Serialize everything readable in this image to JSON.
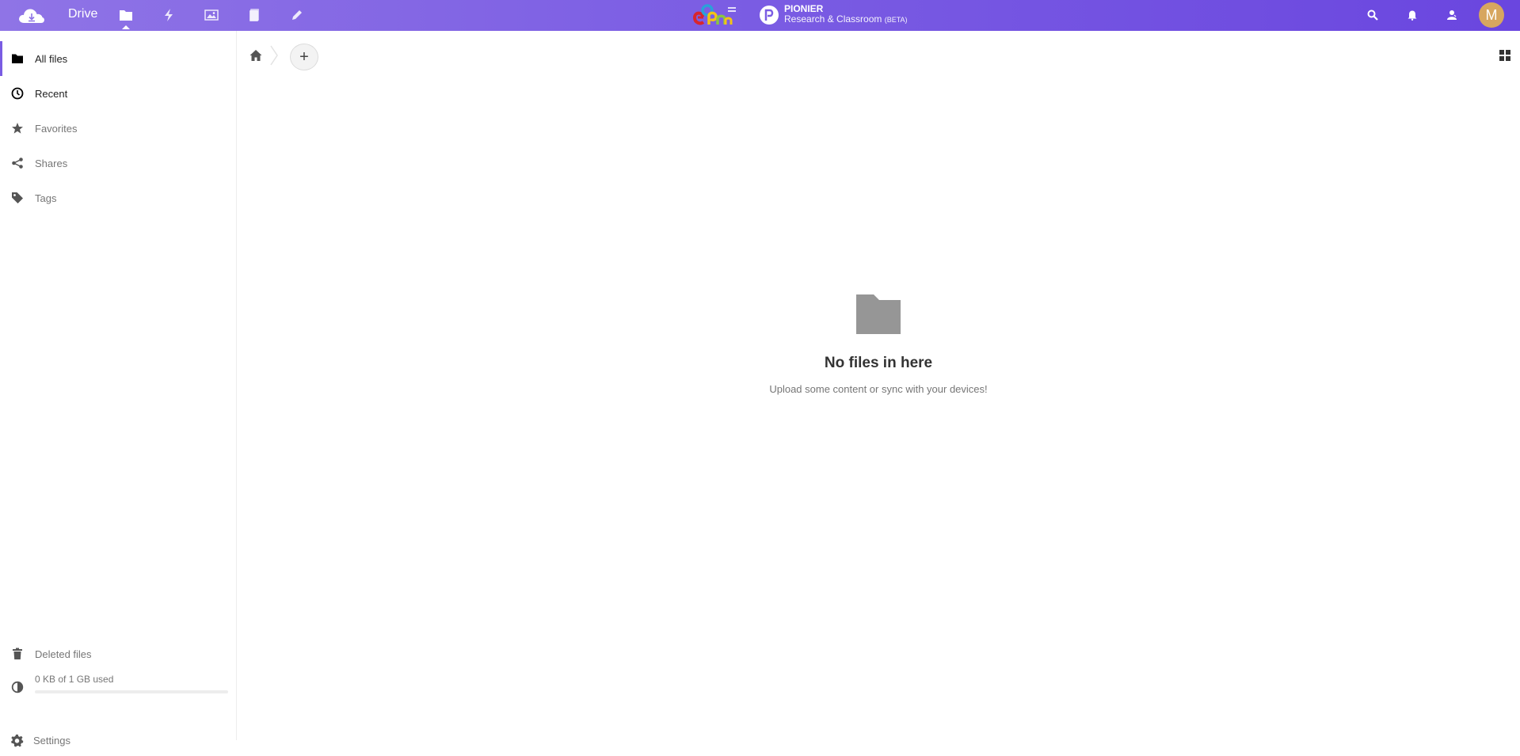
{
  "header": {
    "app_name": "Drive",
    "apps": [
      {
        "name": "files-app-icon",
        "active": true
      },
      {
        "name": "activity-app-icon"
      },
      {
        "name": "photos-app-icon"
      },
      {
        "name": "deck-app-icon"
      },
      {
        "name": "notes-app-icon"
      }
    ],
    "brand": {
      "title": "PIONIER",
      "subtitle": "Research & Classroom",
      "badge": "(BETA)"
    },
    "avatar_initial": "M",
    "colors": {
      "accent": "#7a5ce3",
      "avatar": "#d7a65f"
    }
  },
  "sidebar": {
    "items": [
      {
        "label": "All files",
        "icon": "folder-icon"
      },
      {
        "label": "Recent",
        "icon": "clock-icon"
      },
      {
        "label": "Favorites",
        "icon": "star-icon"
      },
      {
        "label": "Shares",
        "icon": "share-icon"
      },
      {
        "label": "Tags",
        "icon": "tag-icon"
      }
    ],
    "deleted_label": "Deleted files",
    "quota": {
      "label": "0 KB of 1 GB used",
      "used_fraction": 0
    },
    "settings_label": "Settings"
  },
  "main": {
    "new_button_label": "+",
    "empty": {
      "title": "No files in here",
      "hint": "Upload some content or sync with your devices!"
    }
  }
}
